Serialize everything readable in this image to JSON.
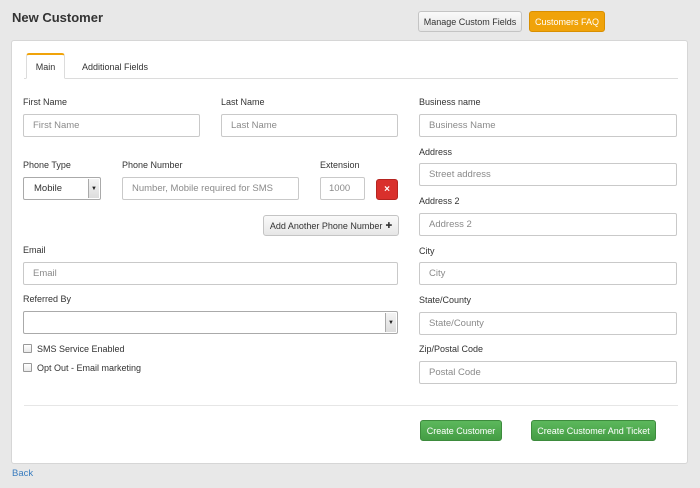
{
  "header": {
    "title": "New Customer",
    "manage_custom_fields": "Manage Custom Fields",
    "customers_faq": "Customers FAQ"
  },
  "tabs": [
    {
      "label": "Main",
      "active": true
    },
    {
      "label": "Additional Fields",
      "active": false
    }
  ],
  "form": {
    "first_name": {
      "label": "First Name",
      "placeholder": "First Name",
      "value": ""
    },
    "last_name": {
      "label": "Last Name",
      "placeholder": "Last Name",
      "value": ""
    },
    "phone_type": {
      "label": "Phone Type",
      "value": "Mobile"
    },
    "phone_number": {
      "label": "Phone Number",
      "placeholder": "Number, Mobile required for SMS",
      "value": ""
    },
    "extension": {
      "label": "Extension",
      "placeholder": "1000",
      "value": ""
    },
    "remove_phone": "×",
    "add_phone": "Add Another Phone Number",
    "add_phone_icon": "✚",
    "email": {
      "label": "Email",
      "placeholder": "Email",
      "value": ""
    },
    "referred_by": {
      "label": "Referred By",
      "value": ""
    },
    "sms_enabled": {
      "label": "SMS Service Enabled",
      "checked": false
    },
    "opt_out_email": {
      "label": "Opt Out - Email marketing",
      "checked": false
    },
    "business_name": {
      "label": "Business name",
      "placeholder": "Business Name",
      "value": ""
    },
    "address": {
      "label": "Address",
      "placeholder": "Street address",
      "value": ""
    },
    "address2": {
      "label": "Address 2",
      "placeholder": "Address 2",
      "value": ""
    },
    "city": {
      "label": "City",
      "placeholder": "City",
      "value": ""
    },
    "state": {
      "label": "State/County",
      "placeholder": "State/County",
      "value": ""
    },
    "zip": {
      "label": "Zip/Postal Code",
      "placeholder": "Postal Code",
      "value": ""
    }
  },
  "actions": {
    "create_customer": "Create Customer",
    "create_customer_and_ticket": "Create Customer And Ticket"
  },
  "footer": {
    "back": "Back"
  },
  "colors": {
    "accent_orange": "#f0a30a",
    "success_green": "#5cb85c",
    "danger_red": "#d9302c",
    "link_blue": "#3a7dbf"
  }
}
